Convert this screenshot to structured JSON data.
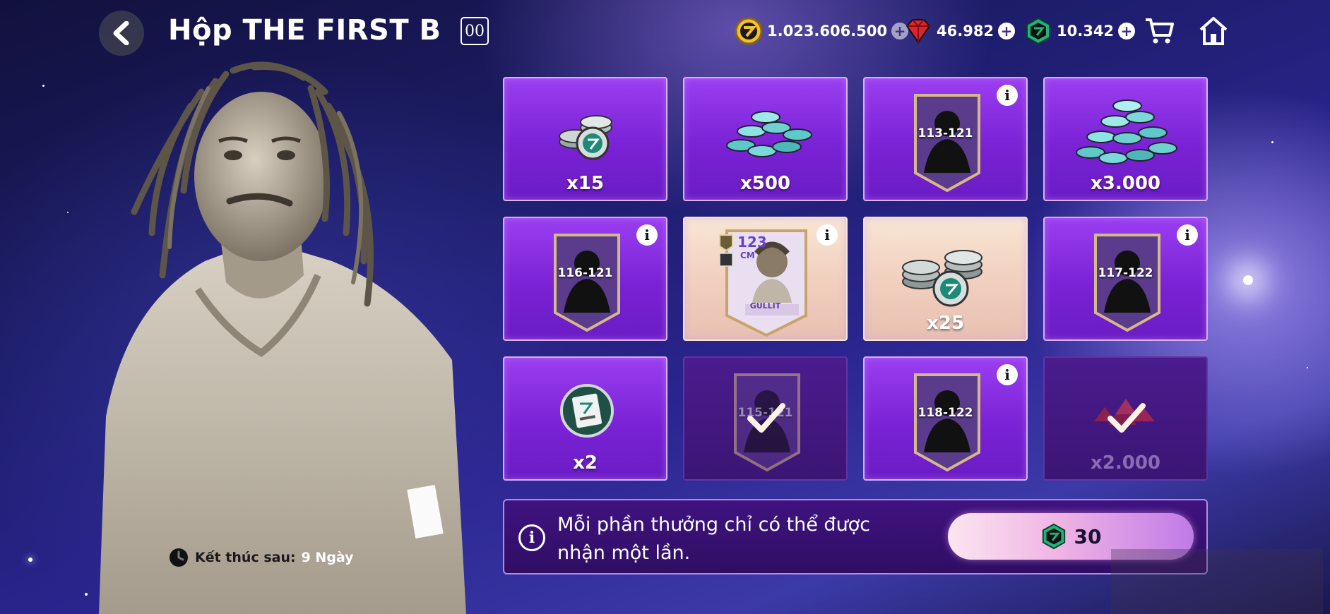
{
  "header": {
    "title": "Hộp THE FIRST B",
    "badge": "00",
    "currencies": [
      {
        "name": "coins",
        "icon": "gold-coin-icon",
        "amount": "1.023.606.500",
        "color": "#f2c12e"
      },
      {
        "name": "gems",
        "icon": "red-gem-icon",
        "amount": "46.982",
        "color": "#e0242b"
      },
      {
        "name": "tokens",
        "icon": "green-token-icon",
        "amount": "10.342",
        "color": "#1fb57a"
      }
    ]
  },
  "rewards": {
    "r1": {
      "qty": "x15"
    },
    "r2": {
      "qty": "x500"
    },
    "r3": {
      "range": "113-121"
    },
    "r4": {
      "qty": "x3.000"
    },
    "r5": {
      "range": "116-121"
    },
    "r6": {
      "ovr": "123",
      "pos": "CM",
      "name": "GULLIT"
    },
    "r7": {
      "qty": "x25"
    },
    "r8": {
      "range": "117-122"
    },
    "r9": {
      "qty": "x2"
    },
    "r10": {
      "range": "115-121"
    },
    "r11": {
      "range": "118-122"
    },
    "r12": {
      "qty": "x2.000"
    }
  },
  "info": {
    "message": "Mỗi phần thưởng chỉ có thể được nhận một lần.",
    "price": "30"
  },
  "timer": {
    "label": "Kết thúc sau:",
    "value": "9 Ngày"
  }
}
